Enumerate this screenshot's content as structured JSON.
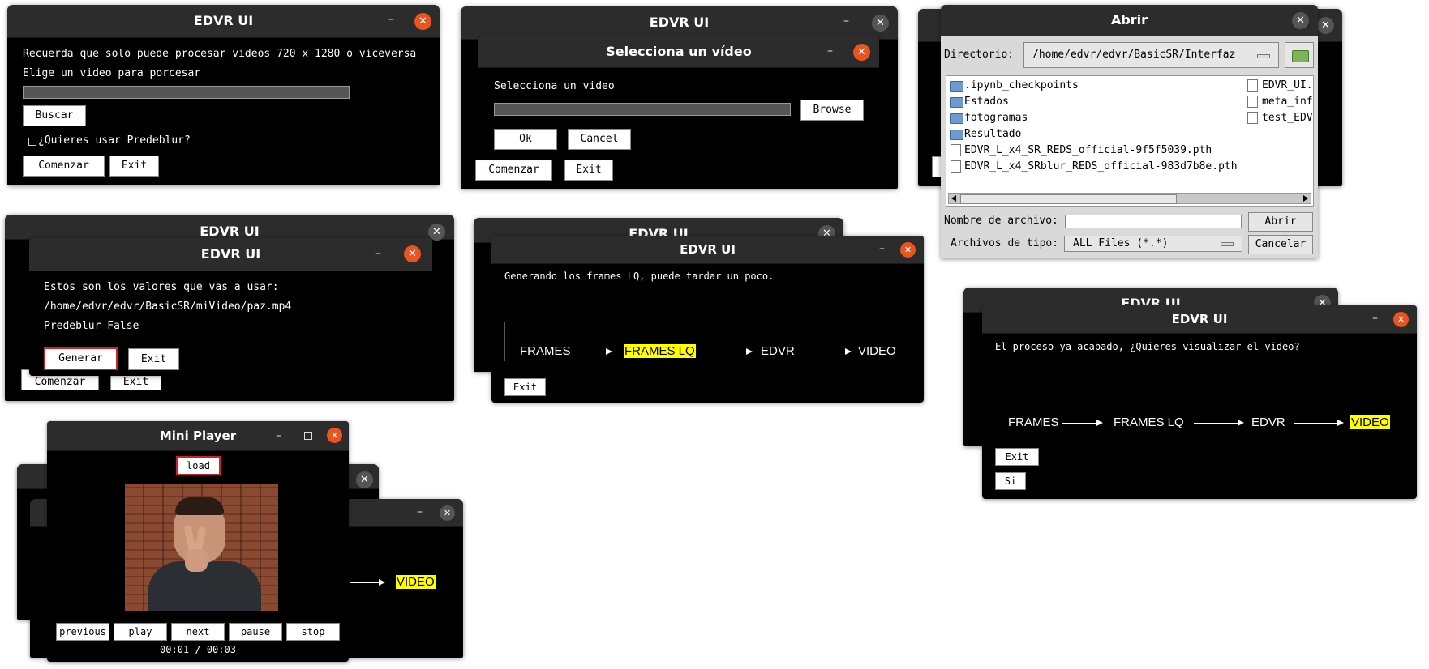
{
  "app_title": "EDVR UI",
  "close_glyph": "✕",
  "min_glyph": "–",
  "win1": {
    "line1": "Recuerda que solo puede procesar videos 720 x 1280 o viceversa",
    "line2": "Elige un video para porcesar",
    "search_button": "Buscar",
    "checkbox_label": "¿Quieres usar Predeblur?",
    "start_button": "Comenzar",
    "exit_button": "Exit"
  },
  "win2": {
    "dialog_title": "Selecciona un vídeo",
    "prompt": "Selecciona un video",
    "browse_button": "Browse",
    "ok_button": "Ok",
    "cancel_button": "Cancel",
    "start_button": "Comenzar",
    "exit_button": "Exit"
  },
  "win3": {
    "dialog_title": "Abrir",
    "directory_label": "Directorio:",
    "directory_value": "/home/edvr/edvr/BasicSR/Interfaz",
    "folders": [
      ".ipynb_checkpoints",
      "Estados",
      "fotogramas",
      "Resultado"
    ],
    "files_left": [
      "EDVR_L_x4_SR_REDS_official-9f5f5039.pth",
      "EDVR_L_x4_SRblur_REDS_official-983d7b8e.pth"
    ],
    "files_right": [
      "EDVR_UI.",
      "meta_inf",
      "test_EDV"
    ],
    "filename_label": "Nombre de archivo:",
    "open_button": "Abrir",
    "filetype_label": "Archivos de tipo:",
    "filetype_value": "ALL Files (*.*)",
    "cancel_button": "Cancelar"
  },
  "win4": {
    "line1": "Estos son los valores que vas a usar:",
    "path": "/home/edvr/edvr/BasicSR/miVideo/paz.mp4",
    "predeblur": "Predeblur  False",
    "generate_button": "Generar",
    "exit_button": "Exit",
    "bg_start_button": "Comenzar",
    "bg_exit_button": "Exit"
  },
  "win5": {
    "message": "Generando los frames LQ, puede tardar un poco.",
    "steps": [
      "FRAMES",
      "FRAMES LQ",
      "EDVR",
      "VIDEO"
    ],
    "highlighted_step": 1,
    "exit_button": "Exit"
  },
  "win6": {
    "message": "El proceso ya acabado, ¿Quieres visualizar el video?",
    "steps": [
      "FRAMES",
      "FRAMES LQ",
      "EDVR",
      "VIDEO"
    ],
    "highlighted_step": 3,
    "exit_button": "Exit",
    "yes_button": "Si"
  },
  "win7": {
    "title": "Mini Player",
    "load_button": "load",
    "controls": [
      "previous",
      "play",
      "next",
      "pause",
      "stop"
    ],
    "time": "00:01 / 00:03",
    "bg_step": "VIDEO"
  },
  "colors": {
    "accent_close": "#e95420",
    "titlebar": "#2c2c2c",
    "window_body": "#000000",
    "highlight": "#ffff00"
  }
}
